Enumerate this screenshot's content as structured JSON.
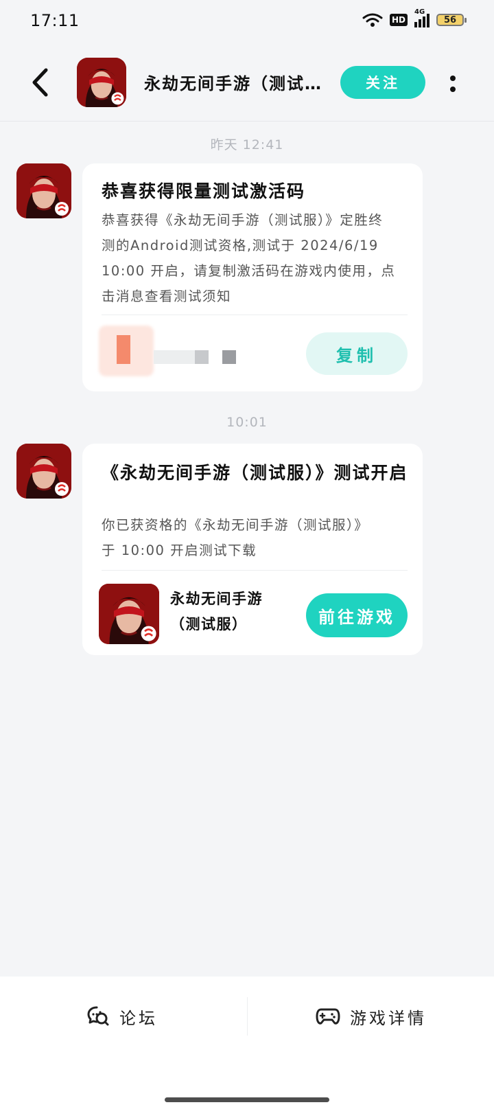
{
  "status_bar": {
    "time": "17:11",
    "hd": "HD",
    "network": "4G",
    "battery": "56"
  },
  "header": {
    "title": "永劫无间手游（测试服）",
    "follow_label": "关注"
  },
  "messages": [
    {
      "timestamp": "昨天  12:41",
      "title": "恭喜获得限量测试激活码",
      "body": "恭喜获得《永劫无间手游（测试服）》定胜终测的Android测试资格,测试于 2024/6/19 10:00 开启，请复制激活码在游戏内使用，点击消息查看测试须知",
      "action_label": "复制"
    },
    {
      "timestamp": "10:01",
      "title": "《永劫无间手游（测试服）》测试开启",
      "body": "你已获资格的《永劫无间手游（测试服）》于 10:00 开启测试下载",
      "game_name": "永劫无间手游（测试服）",
      "action_label": "前往游戏"
    }
  ],
  "bottom_nav": {
    "forum_label": "论坛",
    "game_detail_label": "游戏详情"
  },
  "colors": {
    "accent": "#1fd3c0",
    "accent_soft": "#e2f7f4",
    "background": "#f4f5f7"
  }
}
